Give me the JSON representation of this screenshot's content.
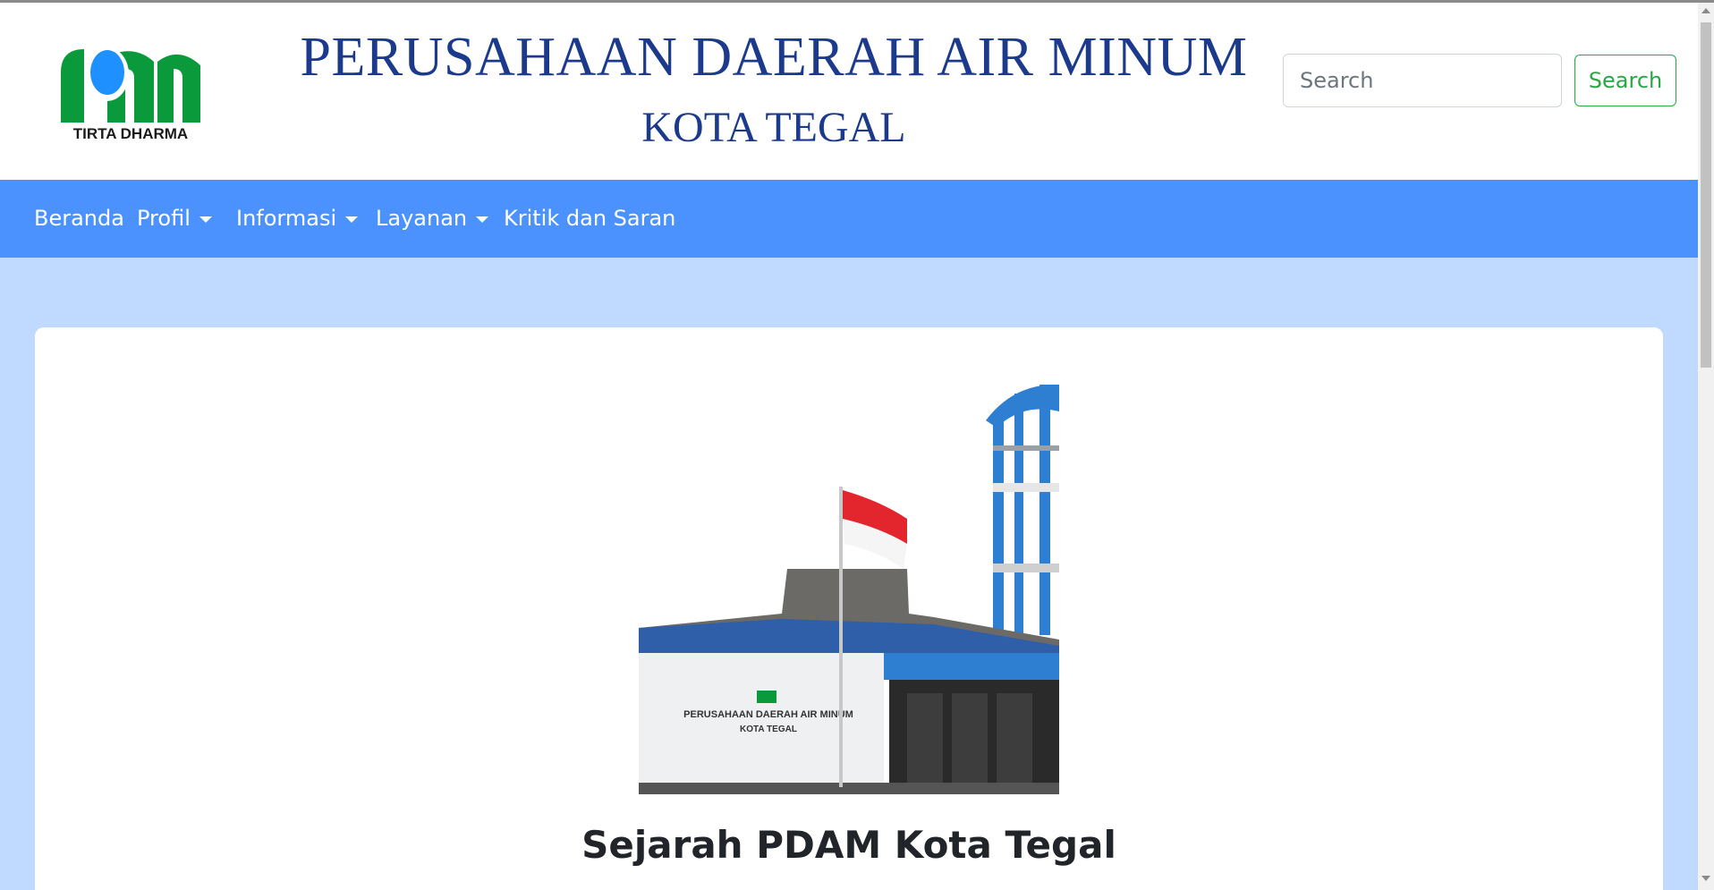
{
  "header": {
    "logo_text": "TIRTA DHARMA",
    "title_line1": "PERUSAHAAN DAERAH AIR MINUM",
    "title_line2": "KOTA TEGAL"
  },
  "search": {
    "placeholder": "Search",
    "button_label": "Search"
  },
  "nav": {
    "items": [
      {
        "label": "Beranda",
        "dropdown": false
      },
      {
        "label": "Profil",
        "dropdown": true
      },
      {
        "label": "Informasi",
        "dropdown": true
      },
      {
        "label": "Layanan",
        "dropdown": true
      },
      {
        "label": "Kritik dan Saran",
        "dropdown": false
      }
    ]
  },
  "main": {
    "photo_sign_line1": "PERUSAHAAN DAERAH AIR MINUM",
    "photo_sign_line2": "KOTA TEGAL",
    "section_title": "Sejarah PDAM Kota Tegal"
  },
  "colors": {
    "brand_title": "#1c3a8c",
    "navbar": "#4b92ff",
    "content_bg": "#bfd9ff",
    "search_button": "#28a745",
    "logo_green": "#0a9a3c",
    "logo_blue": "#1e90ff"
  }
}
